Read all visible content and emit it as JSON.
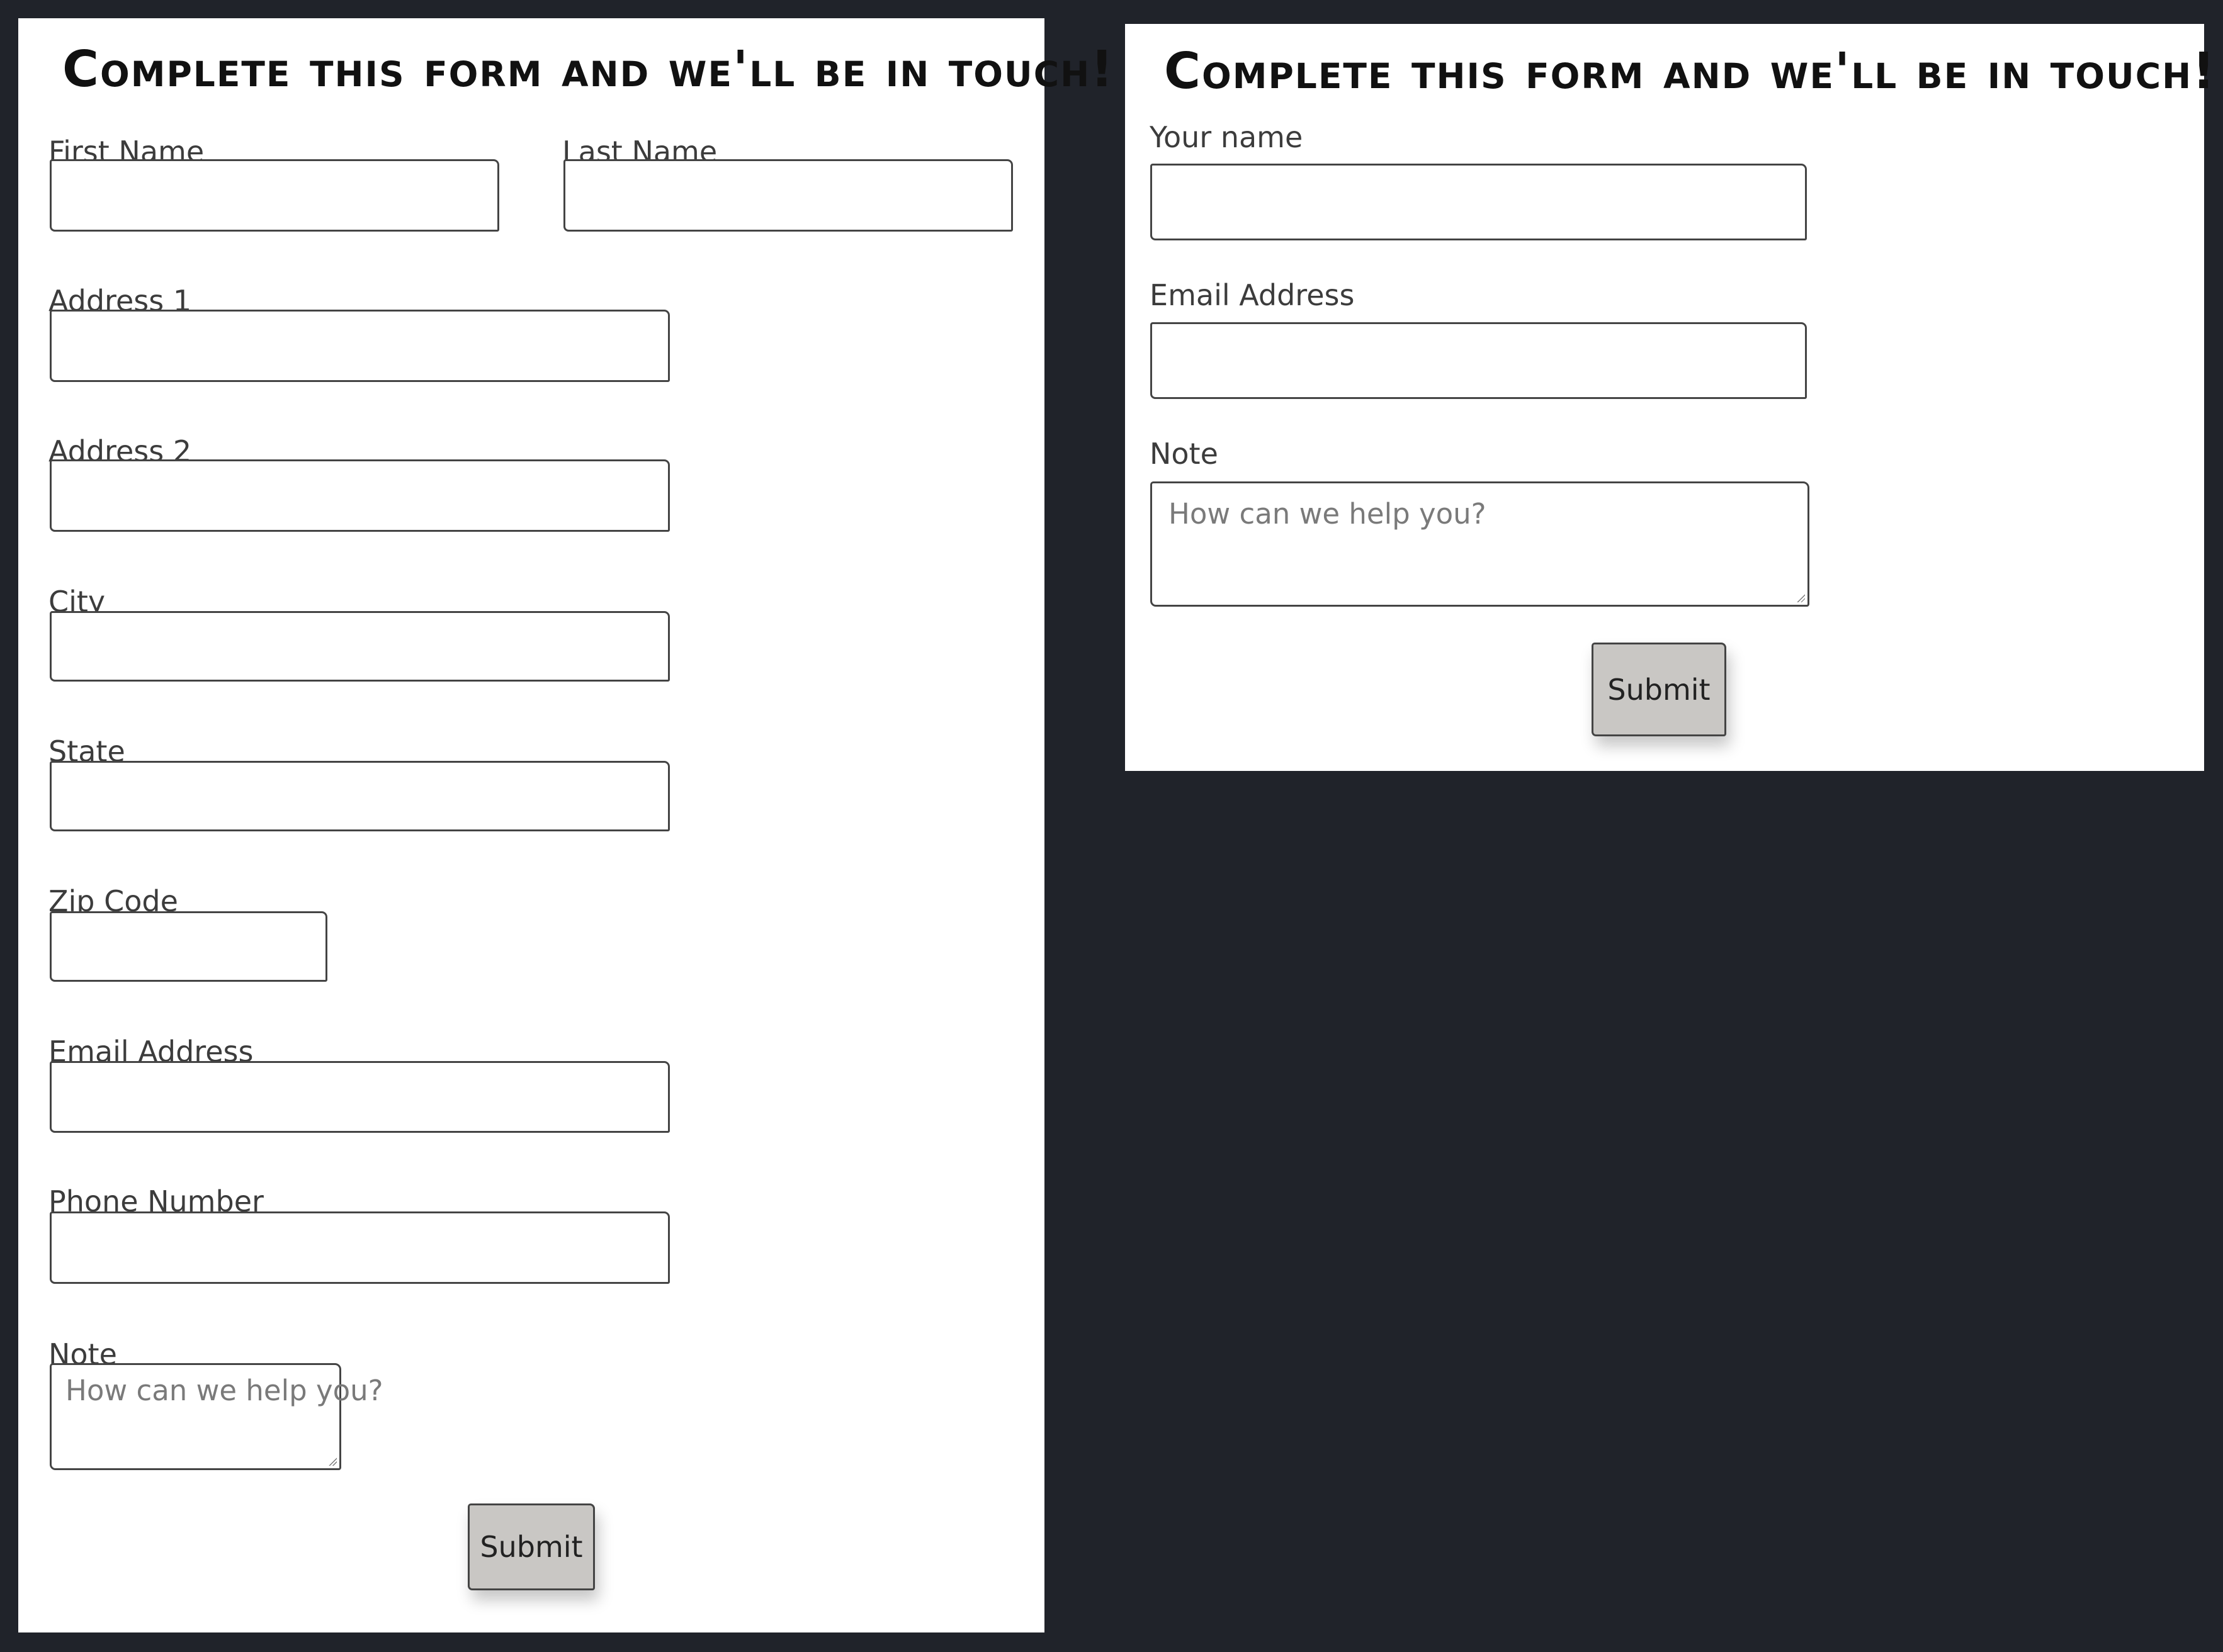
{
  "full_form": {
    "title": "Complete this form and we'll be in touch!",
    "first_name_label": "First Name",
    "last_name_label": "Last Name",
    "address1_label": "Address 1",
    "address2_label": "Address 2",
    "city_label": "City",
    "state_label": "State",
    "zip_label": "Zip Code",
    "email_label": "Email Address",
    "phone_label": "Phone Number",
    "note_label": "Note",
    "note_placeholder": "How can we help you?",
    "submit_label": "Submit"
  },
  "short_form": {
    "title": "Complete this form and we'll be in touch!",
    "name_label": "Your name",
    "email_label": "Email Address",
    "note_label": "Note",
    "note_placeholder": "How can we help you?",
    "submit_label": "Submit"
  }
}
